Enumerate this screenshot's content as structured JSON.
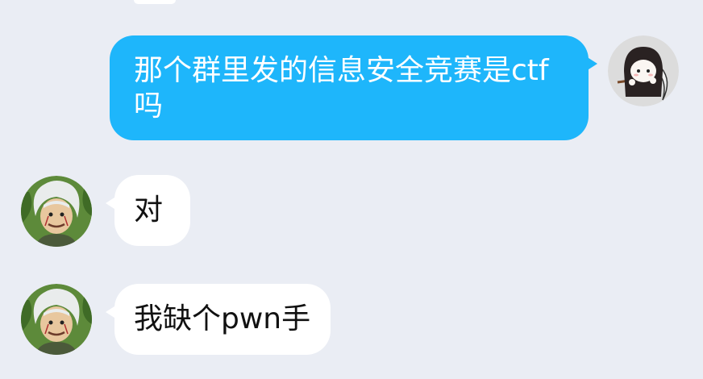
{
  "chat": {
    "messages": [
      {
        "sender": "me",
        "text": "那个群里发的信息安全竞赛是ctf吗",
        "avatar_icon": "reaper-chibi-avatar-icon"
      },
      {
        "sender": "contact",
        "text": "对",
        "avatar_icon": "white-haired-ninja-avatar-icon"
      },
      {
        "sender": "contact",
        "text": "我缺个pwn手",
        "avatar_icon": "white-haired-ninja-avatar-icon"
      }
    ]
  },
  "colors": {
    "background": "#eaedf4",
    "outgoing_bubble": "#1eb6fb",
    "incoming_bubble": "#ffffff",
    "outgoing_text": "#ffffff",
    "incoming_text": "#111111"
  }
}
